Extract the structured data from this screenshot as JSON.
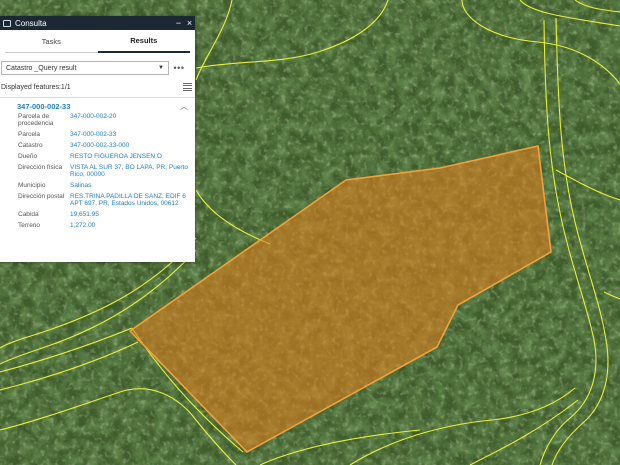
{
  "map": {
    "colors": {
      "imagery_base": "#3f5d2c",
      "parcel_line": "#e8f03a",
      "selection_fill": "#e07f1e",
      "selection_outline": "#f2a23a"
    }
  },
  "panel": {
    "title": "Consulta",
    "minimize_glyph": "−",
    "close_glyph": "×",
    "tabs": [
      {
        "label": "Tasks",
        "active": false
      },
      {
        "label": "Results",
        "active": true
      }
    ],
    "layer_select": {
      "value": "Catastro _Query result"
    },
    "more_glyph": "•••",
    "features_label": "Displayed features:",
    "features_count": "1/1",
    "feature": {
      "title": "347-000-002-33",
      "collapse_glyph": "︿",
      "attributes": [
        {
          "key": "Parcela de procedencia",
          "value": "347-000-002-20"
        },
        {
          "key": "Parcela",
          "value": "347-000-002-33"
        },
        {
          "key": "Catastro",
          "value": "347-000-002-33-000"
        },
        {
          "key": "Dueño",
          "value": "RESTO FIGUEROA JENSEN O"
        },
        {
          "key": "Dirección física",
          "value": "VISTA AL SUR 37, BO LAPA, PR, Puerto Rico, 00000"
        },
        {
          "key": "Municipio",
          "value": "Salinas"
        },
        {
          "key": "Dirección postal",
          "value": "RES.TRINA PADILLA DE SANZ, EDIF 6 APT 697, PR, Estados Unidos, 00612"
        },
        {
          "key": "Cabida",
          "value": "19,651.95"
        },
        {
          "key": "Terreno",
          "value": "1,272.00"
        }
      ]
    }
  }
}
